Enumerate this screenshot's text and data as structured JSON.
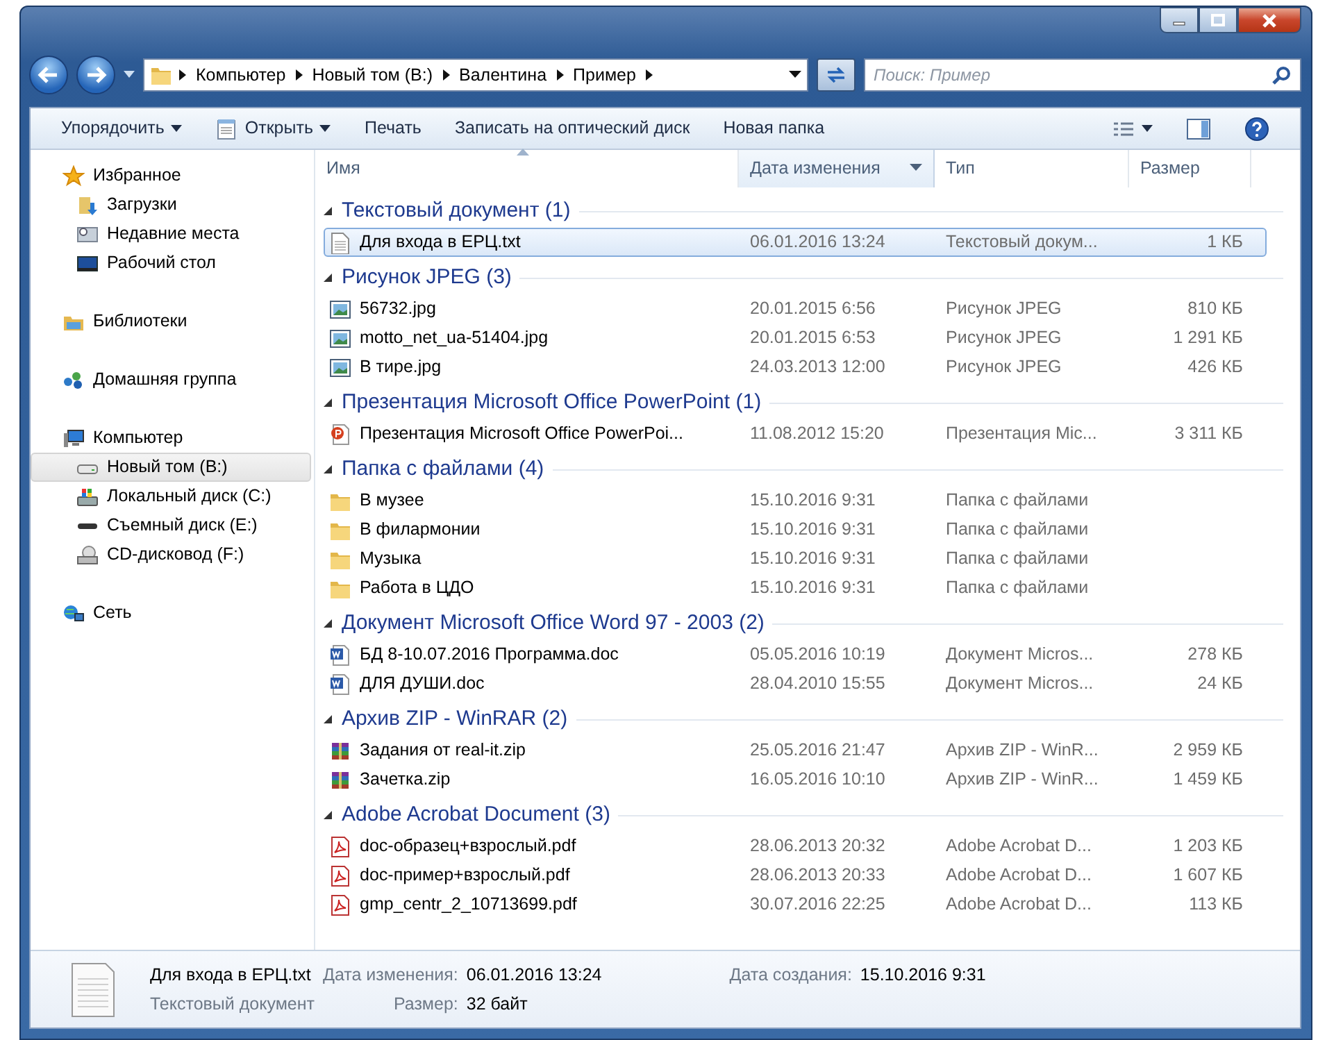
{
  "address_bar": {
    "crumbs": [
      "Компьютер",
      "Новый том (B:)",
      "Валентина",
      "Пример"
    ]
  },
  "search": {
    "placeholder": "Поиск: Пример"
  },
  "toolbar": {
    "buttons": [
      {
        "label": "Упорядочить",
        "kind": "menu"
      },
      {
        "label": "Открыть",
        "kind": "open"
      },
      {
        "label": "Печать",
        "kind": "plain"
      },
      {
        "label": "Записать на оптический диск",
        "kind": "plain"
      },
      {
        "label": "Новая папка",
        "kind": "plain"
      }
    ]
  },
  "sidebar": {
    "sections": [
      {
        "label": "Избранное",
        "kind": "favorites",
        "selected": false,
        "children": [
          {
            "label": "Загрузки",
            "kind": "downloads",
            "selected": false
          },
          {
            "label": "Недавние места",
            "kind": "recent",
            "selected": false
          },
          {
            "label": "Рабочий стол",
            "kind": "desktop",
            "selected": false
          }
        ]
      },
      {
        "label": "Библиотеки",
        "kind": "library",
        "selected": false
      },
      {
        "label": "Домашняя группа",
        "kind": "homegroup",
        "selected": false
      },
      {
        "label": "Компьютер",
        "kind": "computer",
        "selected": false,
        "children": [
          {
            "label": "Новый том (B:)",
            "kind": "drive",
            "selected": true
          },
          {
            "label": "Локальный диск (C:)",
            "kind": "sysdrive",
            "selected": false
          },
          {
            "label": "Съемный диск (E:)",
            "kind": "removable",
            "selected": false
          },
          {
            "label": "CD-дисковод (F:)",
            "kind": "cd",
            "selected": false
          }
        ]
      },
      {
        "label": "Сеть",
        "kind": "network",
        "selected": false
      }
    ]
  },
  "columns": [
    {
      "label": "Имя",
      "sorted": true,
      "hovered": false
    },
    {
      "label": "Дата изменения",
      "sorted": false,
      "hovered": true
    },
    {
      "label": "Тип",
      "sorted": false,
      "hovered": false
    },
    {
      "label": "Размер",
      "sorted": false,
      "hovered": false
    }
  ],
  "groups": [
    {
      "title": "Текстовый документ (1)",
      "expanded": true,
      "files": [
        {
          "name": "Для входа в ЕРЦ.txt",
          "date": "06.01.2016 13:24",
          "type": "Текстовый докум...",
          "size": "1 КБ",
          "kind": "txt",
          "selected": true
        }
      ]
    },
    {
      "title": "Рисунок JPEG (3)",
      "expanded": true,
      "files": [
        {
          "name": "56732.jpg",
          "date": "20.01.2015 6:56",
          "type": "Рисунок JPEG",
          "size": "810 КБ",
          "kind": "jpg",
          "selected": false
        },
        {
          "name": "motto_net_ua-51404.jpg",
          "date": "20.01.2015 6:53",
          "type": "Рисунок JPEG",
          "size": "1 291 КБ",
          "kind": "jpg",
          "selected": false
        },
        {
          "name": "В тире.jpg",
          "date": "24.03.2013 12:00",
          "type": "Рисунок JPEG",
          "size": "426 КБ",
          "kind": "jpg",
          "selected": false
        }
      ]
    },
    {
      "title": "Презентация Microsoft Office PowerPoint (1)",
      "expanded": true,
      "files": [
        {
          "name": "Презентация Microsoft Office PowerPoi...",
          "date": "11.08.2012 15:20",
          "type": "Презентация Mic...",
          "size": "3 311 КБ",
          "kind": "ppt",
          "selected": false
        }
      ]
    },
    {
      "title": "Папка с файлами (4)",
      "expanded": true,
      "files": [
        {
          "name": "В музее",
          "date": "15.10.2016 9:31",
          "type": "Папка с файлами",
          "kind": "folder",
          "selected": false
        },
        {
          "name": "В филармонии",
          "date": "15.10.2016 9:31",
          "type": "Папка с файлами",
          "kind": "folder",
          "selected": false
        },
        {
          "name": "Музыка",
          "date": "15.10.2016 9:31",
          "type": "Папка с файлами",
          "kind": "folder",
          "selected": false
        },
        {
          "name": "Работа в ЦДО",
          "date": "15.10.2016 9:31",
          "type": "Папка с файлами",
          "kind": "folder",
          "selected": false
        }
      ]
    },
    {
      "title": "Документ Microsoft Office Word 97 - 2003 (2)",
      "expanded": true,
      "files": [
        {
          "name": "БД 8-10.07.2016 Программа.doc",
          "date": "05.05.2016 10:19",
          "type": "Документ Micros...",
          "size": "278 КБ",
          "kind": "doc",
          "selected": false
        },
        {
          "name": "ДЛЯ ДУШИ.doc",
          "date": "28.04.2010 15:55",
          "type": "Документ Micros...",
          "size": "24 КБ",
          "kind": "doc",
          "selected": false
        }
      ]
    },
    {
      "title": "Архив ZIP - WinRAR (2)",
      "expanded": true,
      "files": [
        {
          "name": "Задания от real-it.zip",
          "date": "25.05.2016 21:47",
          "type": "Архив ZIP - WinR...",
          "size": "2 959 КБ",
          "kind": "zip",
          "selected": false
        },
        {
          "name": "Зачетка.zip",
          "date": "16.05.2016 10:10",
          "type": "Архив ZIP - WinR...",
          "size": "1 459 КБ",
          "kind": "zip",
          "selected": false
        }
      ]
    },
    {
      "title": "Adobe Acrobat Document (3)",
      "expanded": true,
      "files": [
        {
          "name": "doc-образец+взрослый.pdf",
          "date": "28.06.2013 20:32",
          "type": "Adobe Acrobat D...",
          "size": "1 203 КБ",
          "kind": "pdf",
          "selected": false
        },
        {
          "name": "doc-пример+взрослый.pdf",
          "date": "28.06.2013 20:33",
          "type": "Adobe Acrobat D...",
          "size": "1 607 КБ",
          "kind": "pdf",
          "selected": false
        },
        {
          "name": "gmp_centr_2_10713699.pdf",
          "date": "30.07.2016 22:25",
          "type": "Adobe Acrobat D...",
          "size": "113 КБ",
          "kind": "pdf",
          "selected": false
        }
      ]
    }
  ],
  "details": {
    "name": "Для входа в ЕРЦ.txt",
    "type": "Текстовый документ",
    "fields": [
      {
        "label": "Дата изменения:",
        "value": "06.01.2016 13:24"
      },
      {
        "label": "Размер:",
        "value": "32 байт"
      },
      {
        "label": "Дата создания:",
        "value": "15.10.2016 9:31"
      }
    ]
  }
}
